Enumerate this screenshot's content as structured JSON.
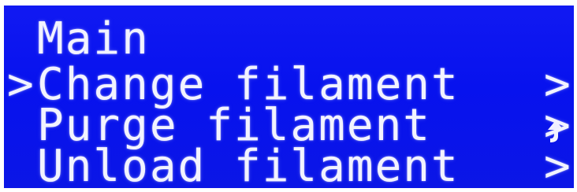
{
  "menu": {
    "title": "Main",
    "back_icon": "back-arrow-icon",
    "selected_index": 0,
    "cursor_glyph": ">",
    "items": [
      {
        "label": "Change filament",
        "chevron": ">"
      },
      {
        "label": "Purge filament",
        "chevron": ">"
      },
      {
        "label": "Unload filament",
        "chevron": ">"
      }
    ]
  },
  "colors": {
    "background": "#0a14f0",
    "text": "#f2f3ff"
  }
}
